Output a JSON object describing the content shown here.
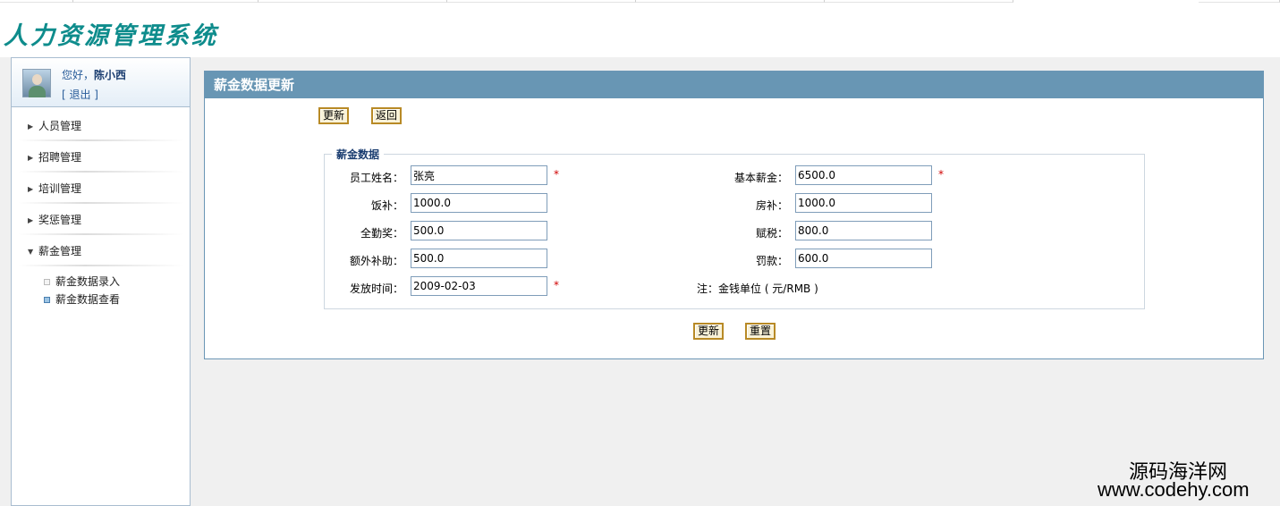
{
  "app": {
    "logo": "人力资源管理系统"
  },
  "user": {
    "greeting": "您好，",
    "name": "陈小西",
    "logout": "[ 退出 ]"
  },
  "sidebar": {
    "menus": [
      {
        "label": "人员管理"
      },
      {
        "label": "招聘管理"
      },
      {
        "label": "培训管理"
      },
      {
        "label": "奖惩管理"
      },
      {
        "label": "薪金管理"
      }
    ],
    "submenus": [
      {
        "label": "薪金数据录入"
      },
      {
        "label": "薪金数据查看"
      }
    ]
  },
  "panel": {
    "title": "薪金数据更新",
    "top_buttons": {
      "update": "更新",
      "back": "返回"
    },
    "fieldset_legend": "薪金数据",
    "fields": {
      "name": {
        "label": "员工姓名：",
        "value": "张亮"
      },
      "base_salary": {
        "label": "基本薪金：",
        "value": "6500.0"
      },
      "meal": {
        "label": "饭补：",
        "value": "1000.0"
      },
      "housing": {
        "label": "房补：",
        "value": "1000.0"
      },
      "attendance": {
        "label": "全勤奖：",
        "value": "500.0"
      },
      "tax": {
        "label": "赋税：",
        "value": "800.0"
      },
      "extra": {
        "label": "额外补助：",
        "value": "500.0"
      },
      "fine": {
        "label": "罚款：",
        "value": "600.0"
      },
      "date": {
        "label": "发放时间：",
        "value": "2009-02-03"
      }
    },
    "required_mark": "*",
    "note": "注：金钱单位 ( 元/RMB )",
    "bottom_buttons": {
      "update": "更新",
      "reset": "重置"
    }
  },
  "watermark": {
    "line1": "源码海洋网",
    "line2": "www.codehy.com"
  }
}
